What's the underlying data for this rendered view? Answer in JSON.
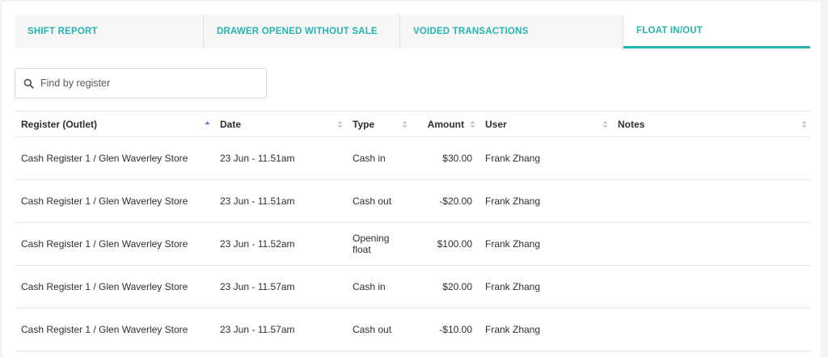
{
  "tabs": [
    {
      "label": "SHIFT REPORT",
      "active": false
    },
    {
      "label": "DRAWER OPENED WITHOUT SALE",
      "active": false
    },
    {
      "label": "VOIDED TRANSACTIONS",
      "active": false
    },
    {
      "label": "FLOAT IN/OUT",
      "active": true
    }
  ],
  "search": {
    "placeholder": "Find by register",
    "value": ""
  },
  "table": {
    "columns": [
      "Register (Outlet)",
      "Date",
      "Type",
      "Amount",
      "User",
      "Notes"
    ],
    "sorted_column": "Register (Outlet)",
    "rows": [
      {
        "register": "Cash Register 1 / Glen Waverley Store",
        "date": "23 Jun - 11.51am",
        "type": "Cash in",
        "amount": "$30.00",
        "user": "Frank Zhang",
        "notes": ""
      },
      {
        "register": "Cash Register 1 / Glen Waverley Store",
        "date": "23 Jun - 11.51am",
        "type": "Cash out",
        "amount": "-$20.00",
        "user": "Frank Zhang",
        "notes": ""
      },
      {
        "register": "Cash Register 1 / Glen Waverley Store",
        "date": "23 Jun - 11.52am",
        "type": "Opening float",
        "amount": "$100.00",
        "user": "Frank Zhang",
        "notes": ""
      },
      {
        "register": "Cash Register 1 / Glen Waverley Store",
        "date": "23 Jun - 11.57am",
        "type": "Cash in",
        "amount": "$20.00",
        "user": "Frank Zhang",
        "notes": ""
      },
      {
        "register": "Cash Register 1 / Glen Waverley Store",
        "date": "23 Jun - 11.57am",
        "type": "Cash out",
        "amount": "-$10.00",
        "user": "Frank Zhang",
        "notes": ""
      }
    ]
  },
  "colors": {
    "accent": "#26b4b0",
    "sort_active": "#5b7fd6",
    "sort_inactive": "#c4c8cc"
  },
  "icons": {
    "search": "search-icon",
    "sort": "sort-arrows-icon",
    "sort_asc": "sort-ascending-icon"
  }
}
